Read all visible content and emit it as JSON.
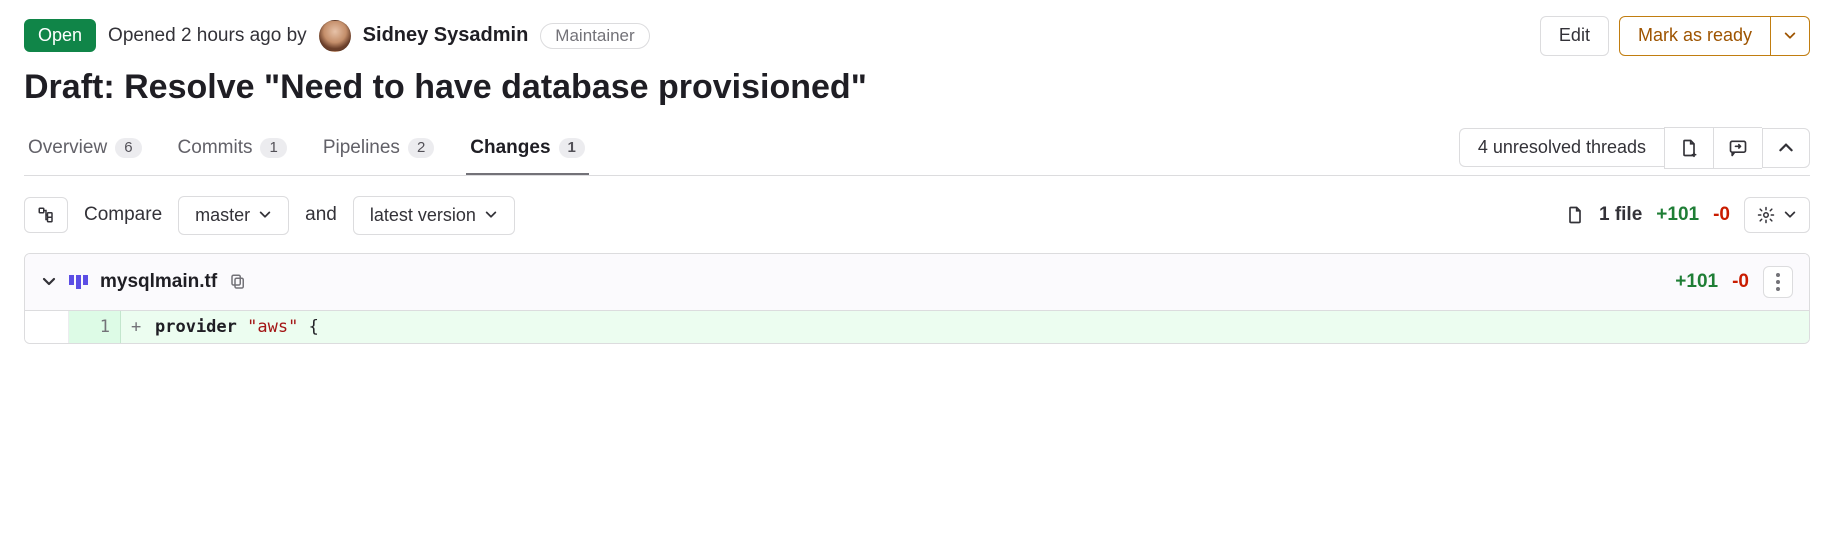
{
  "header": {
    "status": "Open",
    "opened_prefix": "Opened",
    "opened_time": "2 hours ago",
    "opened_by": "by",
    "author": "Sidney Sysadmin",
    "role": "Maintainer",
    "edit_label": "Edit",
    "mark_ready_label": "Mark as ready"
  },
  "title": "Draft: Resolve \"Need to have database provisioned\"",
  "tabs": {
    "overview": {
      "label": "Overview",
      "count": "6"
    },
    "commits": {
      "label": "Commits",
      "count": "1"
    },
    "pipelines": {
      "label": "Pipelines",
      "count": "2"
    },
    "changes": {
      "label": "Changes",
      "count": "1"
    }
  },
  "threads": {
    "label": "4 unresolved threads"
  },
  "compare": {
    "label": "Compare",
    "base": "master",
    "and": "and",
    "head": "latest version",
    "file_count": "1 file",
    "additions": "+101",
    "deletions": "-0"
  },
  "file": {
    "name": "mysqlmain.tf",
    "additions": "+101",
    "deletions": "-0",
    "line1": {
      "new_num": "1",
      "sign": "+",
      "kw": "provider",
      "str": "\"aws\"",
      "brace": "{"
    }
  }
}
